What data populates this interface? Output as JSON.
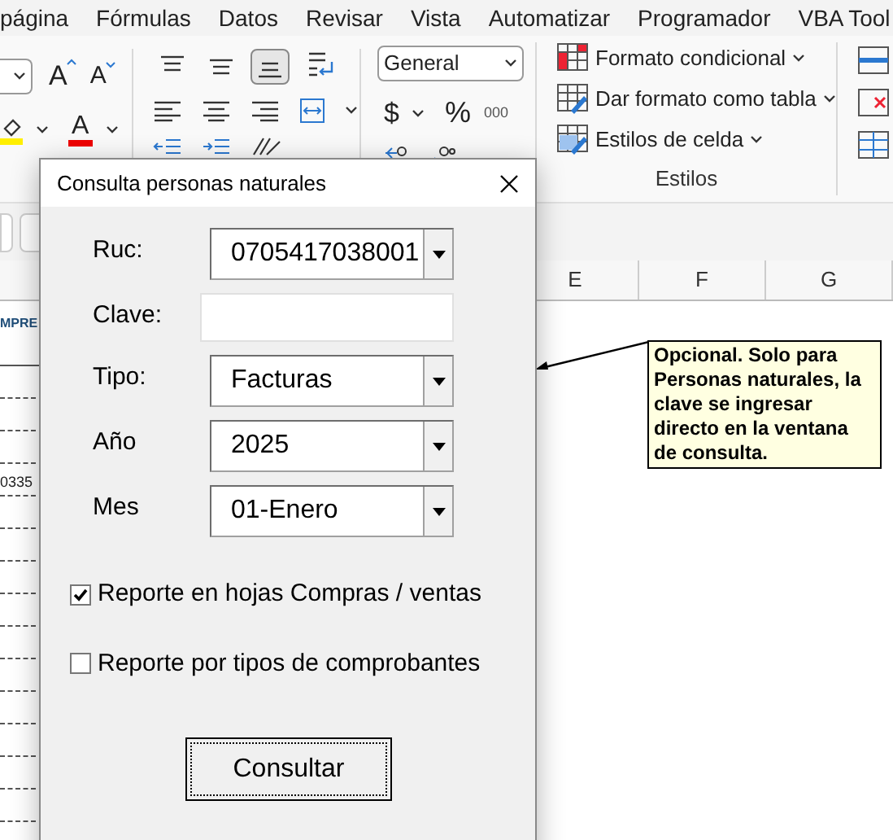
{
  "ribbon_tabs": [
    "página",
    "Fórmulas",
    "Datos",
    "Revisar",
    "Vista",
    "Automatizar",
    "Programador",
    "VBA Tool"
  ],
  "font_group": {
    "grow_font": "A",
    "shrink_font": "A",
    "font_color": "A"
  },
  "alignment": [
    {
      "kind": "top",
      "selected": false
    },
    {
      "kind": "middle",
      "selected": false
    },
    {
      "kind": "bottom",
      "selected": true
    }
  ],
  "number_group": {
    "format": "General",
    "currency": "$",
    "percent": "%",
    "thousands": "000"
  },
  "styles_group": {
    "buttons": [
      {
        "kind": "conditional",
        "label": "Formato condicional"
      },
      {
        "kind": "table",
        "label": "Dar formato como tabla"
      },
      {
        "kind": "cell",
        "label": "Estilos de celda"
      }
    ],
    "label": "Estilos"
  },
  "sheet": {
    "columns": [
      "E",
      "F",
      "G"
    ],
    "header_cell": "MPRE",
    "cell": "0335",
    "note": "Opcional. Solo para Personas naturales, la clave se ingresar directo en la ventana de consulta."
  },
  "dialog": {
    "title": "Consulta personas naturales",
    "fields": [
      {
        "label": "Ruc:",
        "kind": "combo",
        "value": "0705417038001"
      },
      {
        "label": "Clave:",
        "kind": "text"
      },
      {
        "label": "Tipo:",
        "kind": "combo",
        "value": "Facturas"
      },
      {
        "label": "Año",
        "kind": "combo",
        "value": "2025"
      },
      {
        "label": "Mes",
        "kind": "combo",
        "value": "01-Enero"
      }
    ],
    "checkboxes": [
      {
        "label": "Reporte en hojas Compras / ventas",
        "checked": true
      },
      {
        "label": "Reporte por tipos de comprobantes",
        "checked": false
      }
    ],
    "button": "Consultar"
  }
}
